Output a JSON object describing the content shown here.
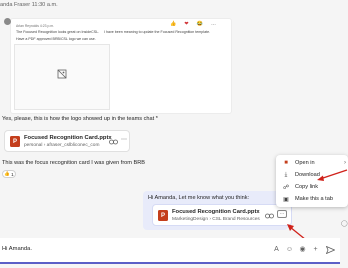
{
  "header": {
    "sender_line": "anda Fraser  11:30 a.m."
  },
  "quote": {
    "meta": "Arlan Reynolds  4:23 p.m.",
    "body1": "The Focused Recognition looks great on InsideCSL.",
    "body2": "I have been meaning to update the Focused Recognition template.",
    "body3": "Have a PDF approved BRB/CSL logo we can use.",
    "reactions": [
      "👍",
      "❤",
      "😂",
      "…"
    ]
  },
  "messages": {
    "line_a": "Yes, please, this is how the logo showed up in the teams chat *",
    "file1": {
      "name": "Focused Recognition Card.pptx",
      "path": "personal › afraser_cslbliconec_com"
    },
    "line_b": "This was the focus recognition card I was given from BRB",
    "reaction": {
      "emoji": "👍",
      "count": "1"
    }
  },
  "outgoing": {
    "text": "Hi Amanda,  Let me know what you think:",
    "file": {
      "name": "Focused Recognition Card.pptx",
      "path": "MarketingDesign › CSL Brand Resources"
    }
  },
  "context_menu": {
    "items": [
      {
        "label": "Open in",
        "icon": "open-in-icon"
      },
      {
        "label": "Download",
        "icon": "download-icon"
      },
      {
        "label": "Copy link",
        "icon": "link-icon"
      },
      {
        "label": "Make this a tab",
        "icon": "tab-icon"
      }
    ]
  },
  "compose": {
    "text": "Hi Amanda."
  },
  "colors": {
    "accent": "#5b5fc7",
    "ppt": "#c43e1c",
    "arrow": "#d0221b",
    "outgoing_bubble": "#e8ebfa"
  }
}
